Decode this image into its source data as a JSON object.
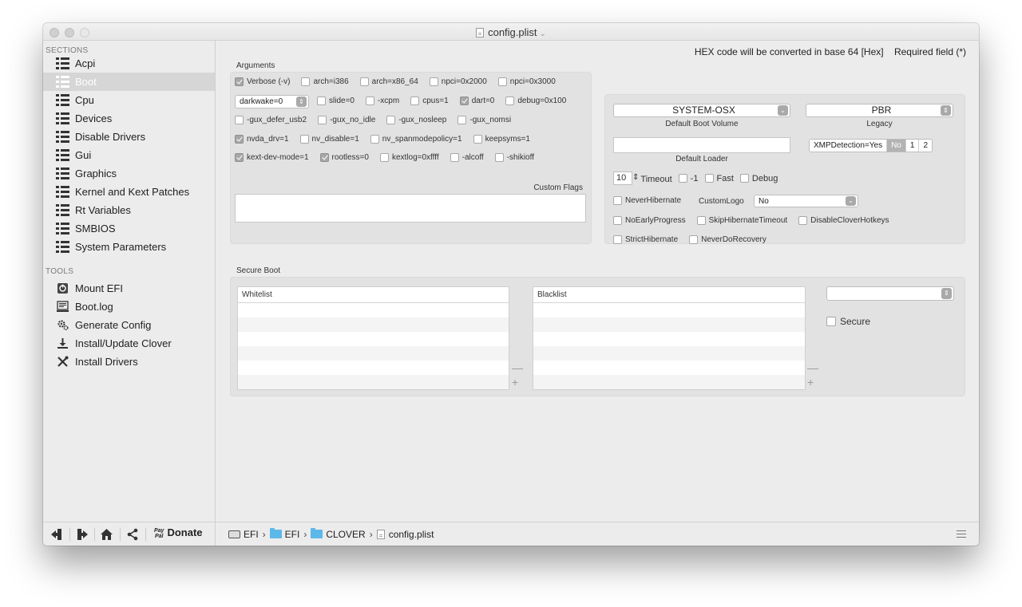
{
  "window": {
    "title": "config.plist",
    "title_chevron": "⌄"
  },
  "sidebar": {
    "sections_header": "SECTIONS",
    "sections": [
      {
        "label": "Acpi",
        "icon": "list-icon"
      },
      {
        "label": "Boot",
        "icon": "list-icon",
        "selected": true
      },
      {
        "label": "Cpu",
        "icon": "list-icon"
      },
      {
        "label": "Devices",
        "icon": "list-icon"
      },
      {
        "label": "Disable Drivers",
        "icon": "list-icon"
      },
      {
        "label": "Gui",
        "icon": "list-icon"
      },
      {
        "label": "Graphics",
        "icon": "list-icon"
      },
      {
        "label": "Kernel and Kext Patches",
        "icon": "list-icon"
      },
      {
        "label": "Rt Variables",
        "icon": "list-icon"
      },
      {
        "label": "SMBIOS",
        "icon": "list-icon"
      },
      {
        "label": "System Parameters",
        "icon": "list-icon"
      }
    ],
    "tools_header": "TOOLS",
    "tools": [
      {
        "label": "Mount EFI",
        "icon": "mount-efi-icon"
      },
      {
        "label": "Boot.log",
        "icon": "log-icon"
      },
      {
        "label": "Generate Config",
        "icon": "gears-icon"
      },
      {
        "label": "Install/Update Clover",
        "icon": "download-icon"
      },
      {
        "label": "Install Drivers",
        "icon": "tools-icon"
      }
    ],
    "bottom": {
      "import_icon": "import-icon",
      "export_icon": "export-icon",
      "home_icon": "home-icon",
      "share_icon": "share-icon",
      "paypal_line1": "Pay",
      "paypal_line2": "Pal",
      "donate_label": "Donate"
    }
  },
  "header": {
    "hex_note": "HEX code will be converted in base 64 [Hex]",
    "required_note": "Required field (*)"
  },
  "arguments": {
    "label": "Arguments",
    "row1": [
      {
        "label": "Verbose (-v)",
        "checked": true
      },
      {
        "label": "arch=i386",
        "checked": false
      },
      {
        "label": "arch=x86_64",
        "checked": false
      },
      {
        "label": "npci=0x2000",
        "checked": false
      },
      {
        "label": "npci=0x3000",
        "checked": false
      }
    ],
    "darkwake_value": "darkwake=0",
    "row2": [
      {
        "label": "slide=0",
        "checked": false
      },
      {
        "label": "-xcpm",
        "checked": false
      },
      {
        "label": "cpus=1",
        "checked": false
      },
      {
        "label": "dart=0",
        "checked": true
      },
      {
        "label": "debug=0x100",
        "checked": false
      }
    ],
    "row3": [
      {
        "label": "-gux_defer_usb2",
        "checked": false
      },
      {
        "label": "-gux_no_idle",
        "checked": false
      },
      {
        "label": "-gux_nosleep",
        "checked": false
      },
      {
        "label": "-gux_nomsi",
        "checked": false
      }
    ],
    "row4": [
      {
        "label": "nvda_drv=1",
        "checked": true
      },
      {
        "label": "nv_disable=1",
        "checked": false
      },
      {
        "label": "nv_spanmodepolicy=1",
        "checked": false
      },
      {
        "label": "keepsyms=1",
        "checked": false
      }
    ],
    "row5": [
      {
        "label": "kext-dev-mode=1",
        "checked": true
      },
      {
        "label": "rootless=0",
        "checked": true
      },
      {
        "label": "kextlog=0xffff",
        "checked": false
      },
      {
        "label": "-alcoff",
        "checked": false
      },
      {
        "label": "-shikioff",
        "checked": false
      }
    ],
    "custom_flags_label": "Custom Flags",
    "custom_flags_value": ""
  },
  "boot": {
    "default_volume_value": "SYSTEM-OSX",
    "default_volume_caption": "Default Boot Volume",
    "legacy_value": "PBR",
    "legacy_caption": "Legacy",
    "default_loader_value": "",
    "default_loader_caption": "Default Loader",
    "xmp_label": "XMPDetection=Yes",
    "xmp_options": [
      "No",
      "1",
      "2"
    ],
    "xmp_selected": "No",
    "timeout_value": "10",
    "timeout_label": "Timeout",
    "timeout_checks": [
      {
        "label": "-1",
        "checked": false
      },
      {
        "label": "Fast",
        "checked": false
      },
      {
        "label": "Debug",
        "checked": false
      }
    ],
    "never_hibernate": {
      "label": "NeverHibernate",
      "checked": false
    },
    "custom_logo_label": "CustomLogo",
    "custom_logo_value": "No",
    "row_progress": [
      {
        "label": "NoEarlyProgress",
        "checked": false
      },
      {
        "label": "SkipHibernateTimeout",
        "checked": false
      },
      {
        "label": "DisableCloverHotkeys",
        "checked": false
      }
    ],
    "row_strict": [
      {
        "label": "StrictHibernate",
        "checked": false
      },
      {
        "label": "NeverDoRecovery",
        "checked": false
      }
    ]
  },
  "secure_boot": {
    "label": "Secure Boot",
    "whitelist_header": "Whitelist",
    "blacklist_header": "Blacklist",
    "policy_value": "",
    "secure_label": "Secure",
    "secure_checked": false,
    "minus": "—",
    "plus": "+"
  },
  "pathbar": {
    "items": [
      "EFI",
      "EFI",
      "CLOVER",
      "config.plist"
    ],
    "separator": "›"
  }
}
